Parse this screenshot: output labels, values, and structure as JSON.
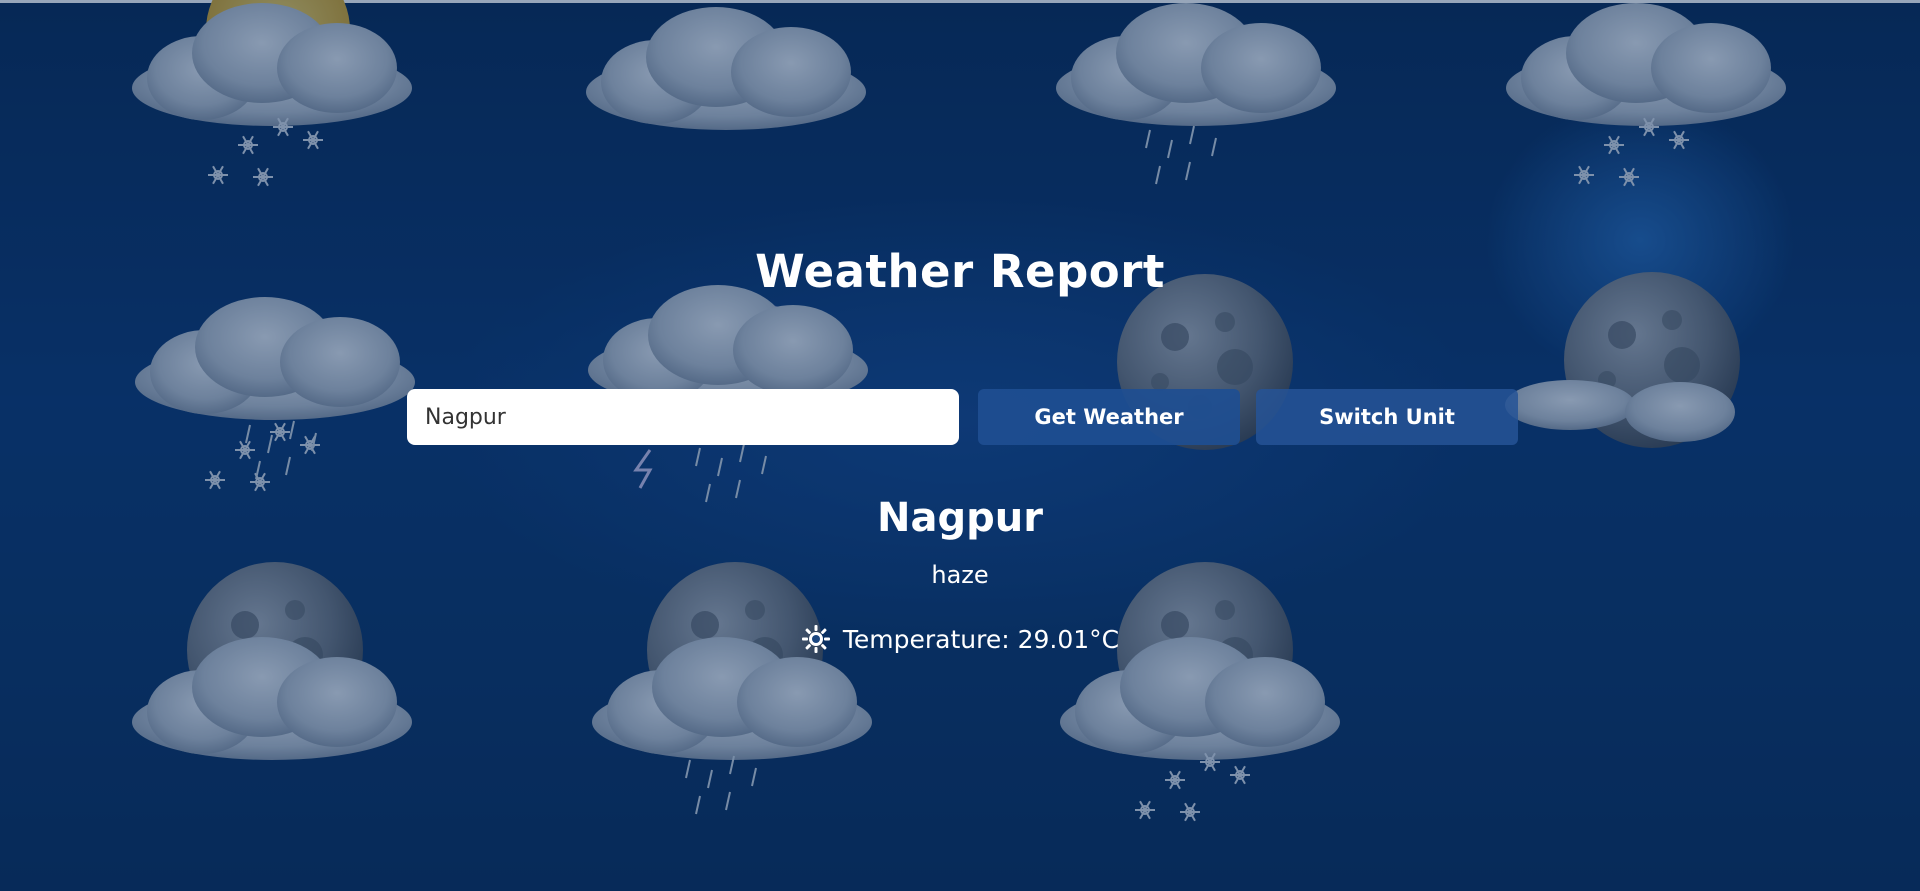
{
  "header": {
    "title": "Weather Report"
  },
  "search": {
    "value": "Nagpur",
    "placeholder": ""
  },
  "buttons": {
    "get_weather": "Get Weather",
    "switch_unit": "Switch Unit"
  },
  "result": {
    "city": "Nagpur",
    "description": "haze",
    "temperature": "Temperature: 29.01°C",
    "temperature_icon": "sun-icon"
  },
  "background": {
    "icons": [
      "partly-sunny-snow-icon",
      "cloud-icon",
      "cloud-rain-icon",
      "cloud-snow-icon",
      "cloud-snow-rain-icon",
      "thunderstorm-icon",
      "moon-icon",
      "moon-cloud-icon",
      "moon-cloud-icon",
      "moon-cloud-rain-icon",
      "moon-cloud-snow-icon"
    ],
    "colors": {
      "base": "#0a3570",
      "dark": "#062753"
    }
  }
}
